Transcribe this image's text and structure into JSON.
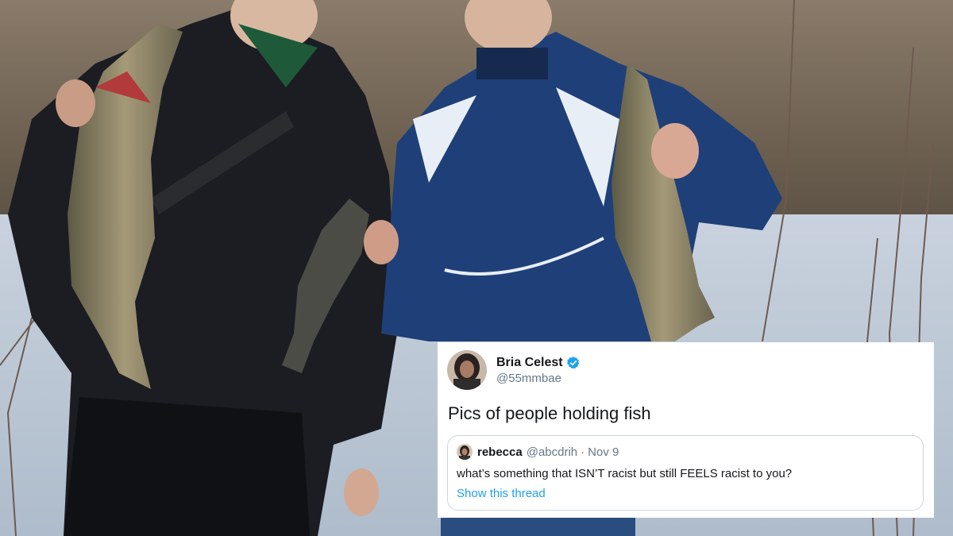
{
  "photo": {
    "description_icon": "fishing-photo"
  },
  "tweet": {
    "display_name": "Bria Celest",
    "handle": "@55mmbae",
    "verified_icon": "verified-badge-icon",
    "text": "Pics of people holding fish",
    "quote": {
      "display_name": "rebecca",
      "handle": "@abcdrih",
      "separator": "·",
      "date": "Nov 9",
      "text": "what’s something that ISN’T racist but still FEELS racist to you?",
      "link_label": "Show this thread"
    }
  },
  "colors": {
    "verified": "#1da1f2",
    "link": "#1da1f2",
    "name": "#14171a",
    "secondary": "#657786",
    "border": "#ccd6dd"
  }
}
